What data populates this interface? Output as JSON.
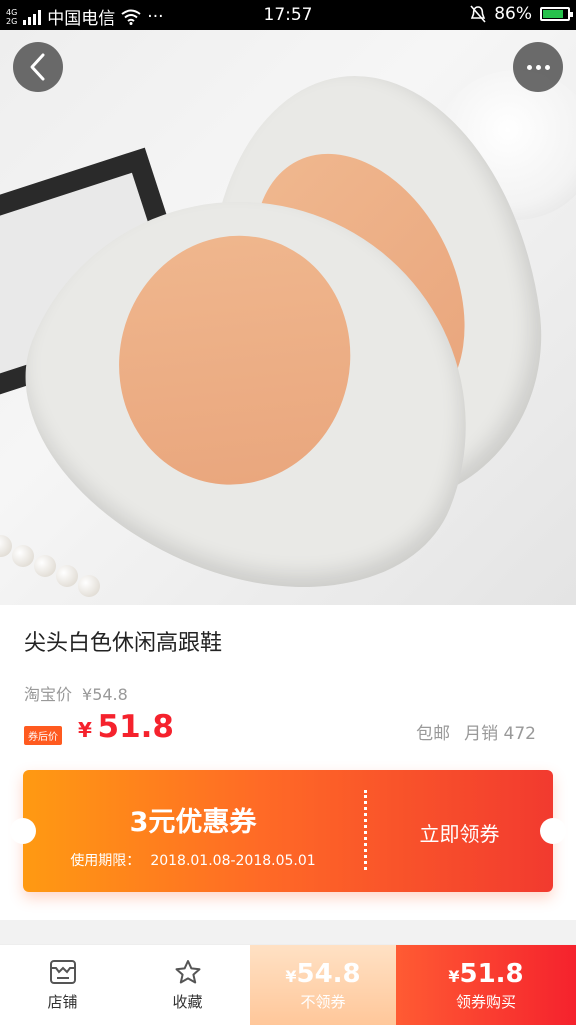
{
  "status_bar": {
    "network_gen": [
      "4G",
      "2G"
    ],
    "carrier": "中国电信",
    "time": "17:57",
    "battery_percent": "86%",
    "battery_level": 0.86
  },
  "hero": {
    "carousel_total": 6,
    "carousel_active": 0
  },
  "product": {
    "title": "尖头白色休闲高跟鞋",
    "original_label": "淘宝价",
    "original_price": "¥54.8",
    "coupon_price_tag": "券后价",
    "price_symbol": "¥",
    "price_value": "51.8",
    "shipping": "包邮",
    "monthly_sales": "月销 472"
  },
  "coupon": {
    "amount_text": "3元优惠券",
    "validity_label": "使用期限：",
    "validity_range": "2018.01.08-2018.05.01",
    "claim_label": "立即领券"
  },
  "bottom_bar": {
    "store_label": "店铺",
    "favorite_label": "收藏",
    "no_claim_symbol": "¥",
    "no_claim_price": "54.8",
    "no_claim_label": "不领券",
    "claim_symbol": "¥",
    "claim_price": "51.8",
    "claim_label": "领券购买"
  },
  "colors": {
    "accent_red": "#f5222d",
    "coupon_orange": "#ff9a12"
  }
}
